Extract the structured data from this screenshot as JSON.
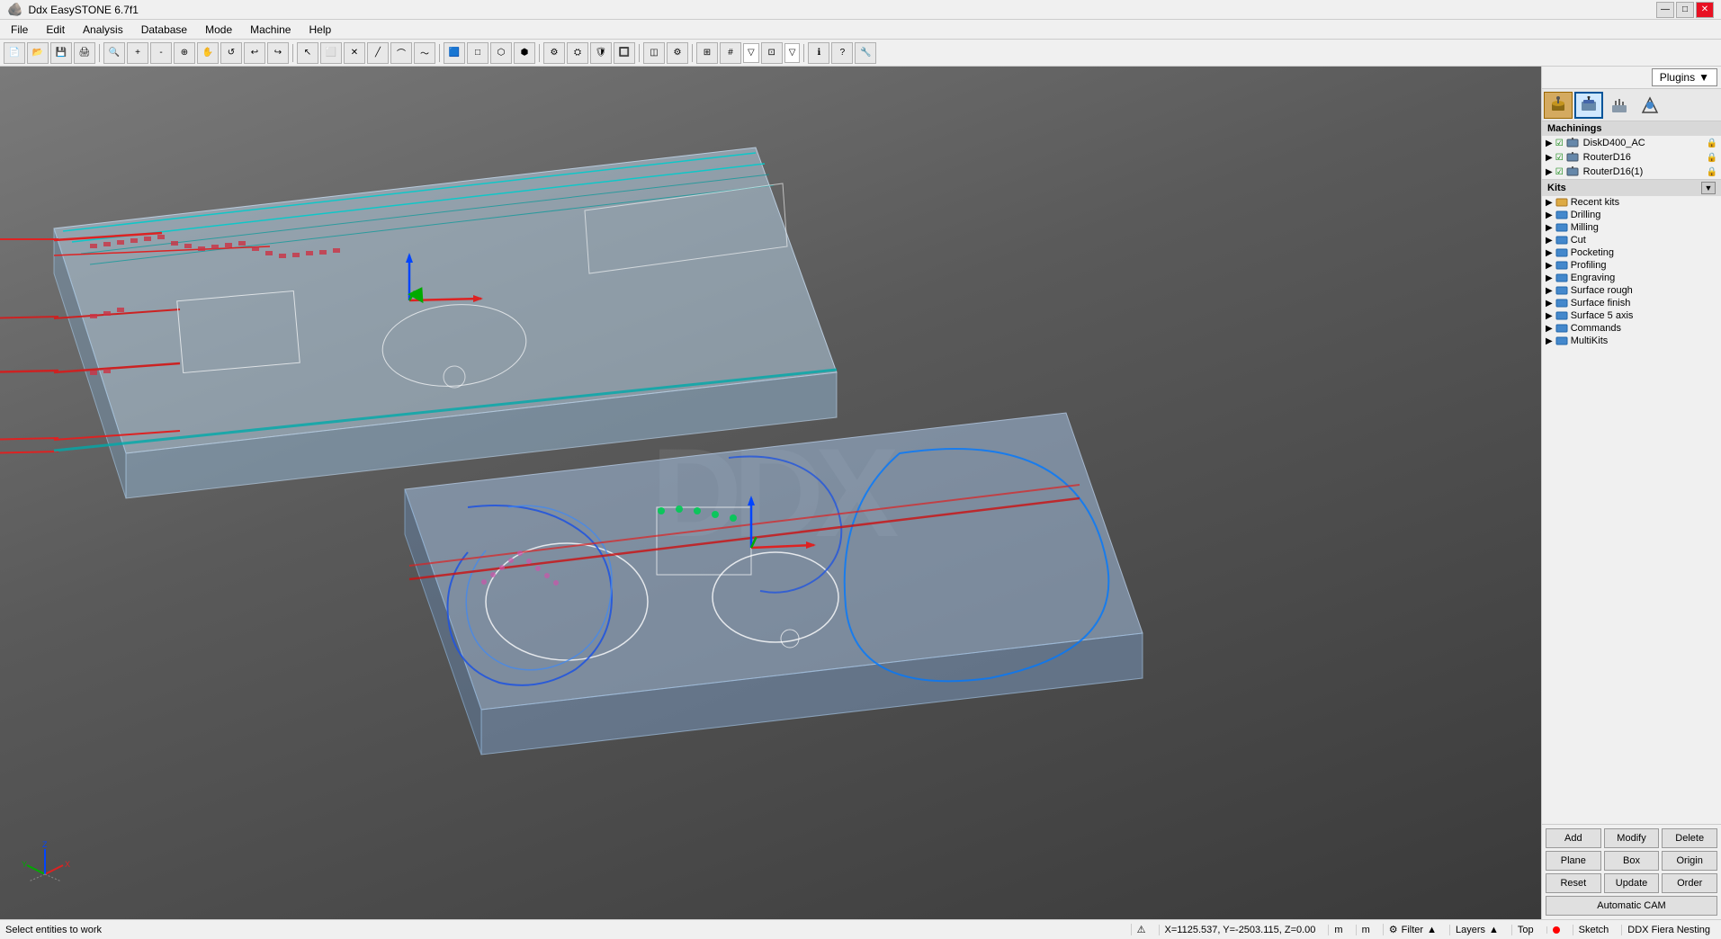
{
  "titleBar": {
    "title": "Ddx EasySTONE 6.7f1",
    "controls": {
      "minimize": "—",
      "maximize": "□",
      "close": "✕"
    }
  },
  "menuBar": {
    "items": [
      "File",
      "Edit",
      "Analysis",
      "Database",
      "Mode",
      "Machine",
      "Help"
    ]
  },
  "pluginsDropdown": {
    "label": "Plugins",
    "arrow": "▼"
  },
  "rightPanel": {
    "icons": [
      {
        "name": "tool-icon1",
        "symbol": "🔨"
      },
      {
        "name": "tool-icon2",
        "symbol": "⬛"
      },
      {
        "name": "tool-icon3",
        "symbol": "▭"
      },
      {
        "name": "tool-icon4",
        "symbol": "🔧"
      }
    ]
  },
  "machinings": {
    "header": "Machinings",
    "items": [
      {
        "label": "DiskD400_AC",
        "checked": true,
        "locked": true
      },
      {
        "label": "RouterD16",
        "checked": true,
        "locked": true
      },
      {
        "label": "RouterD16(1)",
        "checked": true,
        "locked": true
      }
    ]
  },
  "kits": {
    "header": "Kits",
    "items": [
      {
        "label": "Recent kits"
      },
      {
        "label": "Drilling"
      },
      {
        "label": "Milling"
      },
      {
        "label": "Cut"
      },
      {
        "label": "Pocketing"
      },
      {
        "label": "Profiling"
      },
      {
        "label": "Engraving"
      },
      {
        "label": "Surface rough"
      },
      {
        "label": "Surface finish"
      },
      {
        "label": "Surface 5 axis"
      },
      {
        "label": "Commands"
      },
      {
        "label": "MultiKits"
      }
    ]
  },
  "buttons": {
    "add": "Add",
    "modify": "Modify",
    "delete": "Delete",
    "plane": "Plane",
    "box": "Box",
    "origin": "Origin",
    "reset": "Reset",
    "update": "Update",
    "order": "Order",
    "automaticCAM": "Automatic CAM"
  },
  "statusBar": {
    "message": "Select entities to work",
    "coordinates": "X=1125.537, Y=-2503.115, Z=0.00",
    "unit": "m",
    "view": "Top",
    "sketch": "Sketch",
    "nesting": "DDX Fiera Nesting"
  },
  "bottomBar": {
    "filter": "Filter",
    "layers": "Layers",
    "top": "Top"
  }
}
